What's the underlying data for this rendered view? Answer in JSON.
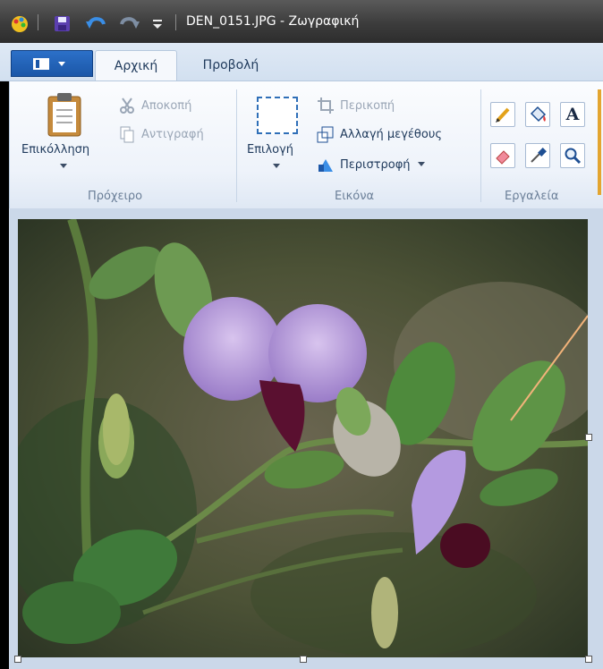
{
  "window": {
    "title": "DEN_0151.JPG - Ζωγραφική"
  },
  "tabs": [
    {
      "label": "Αρχική",
      "active": true
    },
    {
      "label": "Προβολή",
      "active": false
    }
  ],
  "clipboard": {
    "paste_label": "Επικόλληση",
    "cut_label": "Αποκοπή",
    "copy_label": "Αντιγραφή",
    "group_label": "Πρόχειρο"
  },
  "image": {
    "select_label": "Επιλογή",
    "crop_label": "Περικοπή",
    "resize_label": "Αλλαγή μεγέθους",
    "rotate_label": "Περιστροφή",
    "group_label": "Εικόνα"
  },
  "tools": {
    "group_label": "Εργαλεία",
    "text_tool_glyph": "A",
    "items": [
      "pencil-icon",
      "fill-bucket-icon",
      "text-icon",
      "eraser-icon",
      "color-picker-icon",
      "magnifier-icon"
    ]
  },
  "colors": {
    "ribbon_blue": "#1b57a8",
    "brush_line": "#f2b37a"
  }
}
